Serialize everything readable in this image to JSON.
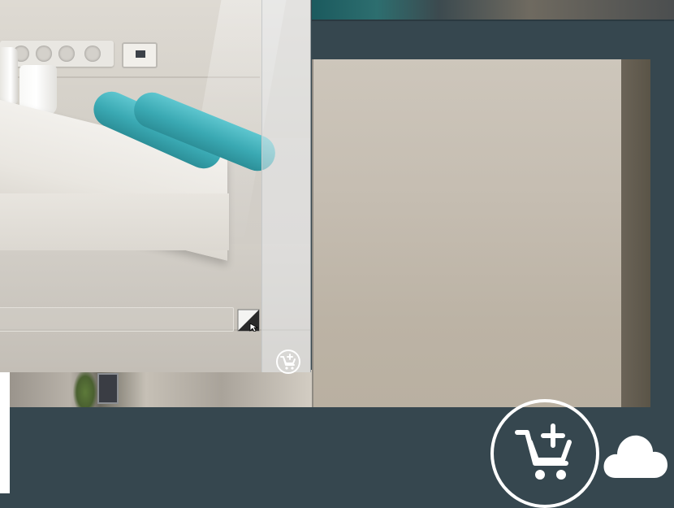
{
  "app": {
    "name": ""
  },
  "viewer": {
    "top_strip": "thumbnail-strip",
    "main_image": "wall-detail-photo",
    "bottom_thumbnail": "bathroom-thumbnail"
  },
  "popup": {
    "photo": "bathroom-vanity-towels-photo",
    "text_field": {
      "value": "",
      "placeholder": ""
    },
    "expand_icon": "expand-corner-icon",
    "cart_icon": "cart-plus-icon"
  },
  "action_bar": {
    "add_to_cart_icon": "cart-plus-icon",
    "cloud_icon": "cloud-icon"
  },
  "colors": {
    "background": "#36474f",
    "accent": "#ffffff",
    "towel": "#3aa9b3"
  }
}
